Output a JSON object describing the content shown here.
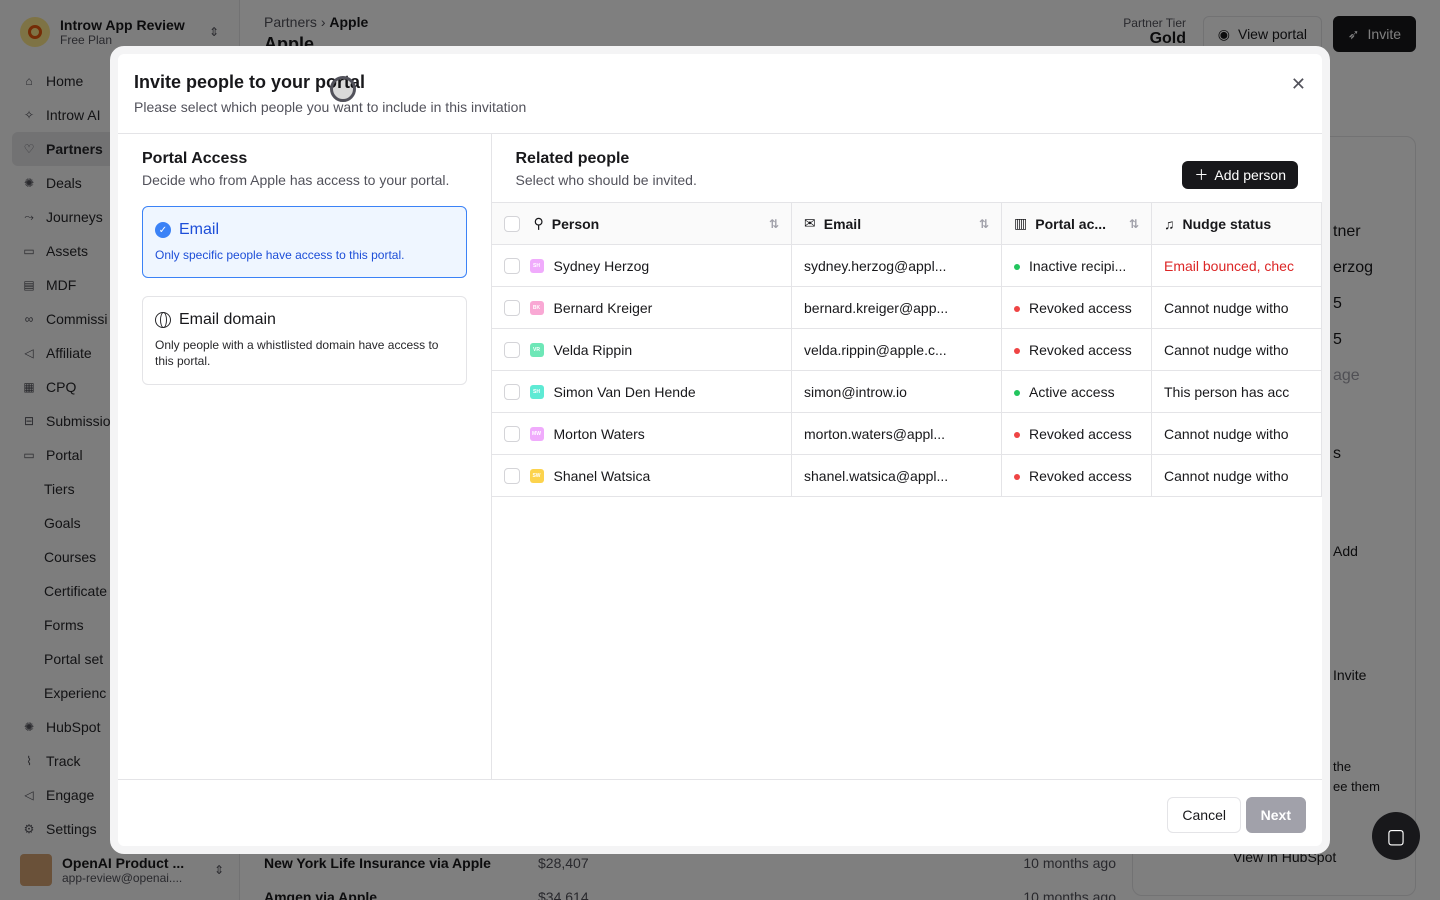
{
  "app": {
    "org_name": "Introw App Review",
    "org_plan": "Free Plan",
    "nav": [
      {
        "label": "Home",
        "icon": "home-icon",
        "glyph": "⌂"
      },
      {
        "label": "Introw AI",
        "icon": "sparkle-icon",
        "glyph": "✧"
      },
      {
        "label": "Partners",
        "icon": "handshake-icon",
        "glyph": "♡",
        "active": true
      },
      {
        "label": "Deals",
        "icon": "hubspot-icon",
        "glyph": "✺"
      },
      {
        "label": "Journeys",
        "icon": "route-icon",
        "glyph": "⤳"
      },
      {
        "label": "Assets",
        "icon": "folder-icon",
        "glyph": "▭"
      },
      {
        "label": "MDF",
        "icon": "document-icon",
        "glyph": "▤"
      },
      {
        "label": "Commissi",
        "icon": "link-icon",
        "glyph": "∞"
      },
      {
        "label": "Affiliate",
        "icon": "megaphone-icon",
        "glyph": "◁"
      },
      {
        "label": "CPQ",
        "icon": "calculator-icon",
        "glyph": "▦"
      },
      {
        "label": "Submissio",
        "icon": "inbox-icon",
        "glyph": "⊟"
      },
      {
        "label": "Portal",
        "icon": "monitor-icon",
        "glyph": "▭"
      },
      {
        "label": "Tiers",
        "sub": true
      },
      {
        "label": "Goals",
        "sub": true
      },
      {
        "label": "Courses",
        "sub": true
      },
      {
        "label": "Certificate",
        "sub": true
      },
      {
        "label": "Forms",
        "sub": true
      },
      {
        "label": "Portal set",
        "sub": true
      },
      {
        "label": "Experienc",
        "sub": true
      },
      {
        "label": "HubSpot",
        "icon": "hubspot-icon",
        "glyph": "✺"
      },
      {
        "label": "Track",
        "icon": "chart-icon",
        "glyph": "⌇"
      },
      {
        "label": "Engage",
        "icon": "megaphone-icon",
        "glyph": "◁"
      },
      {
        "label": "Settings",
        "icon": "gear-icon",
        "glyph": "⚙"
      }
    ],
    "user_name": "OpenAI Product ...",
    "user_email": "app-review@openai....",
    "breadcrumb_root": "Partners",
    "breadcrumb_current": "Apple",
    "page_title": "Apple",
    "tier_label": "Partner Tier",
    "tier_value": "Gold",
    "view_portal": "View portal",
    "invite": "Invite",
    "bg_rows": [
      {
        "name": "New York Life Insurance via Apple",
        "amount": "$28,407",
        "ago": "10 months ago"
      },
      {
        "name": "Amgen via Apple",
        "amount": "$34,614",
        "ago": "10 months ago"
      }
    ],
    "panel": {
      "partner": "tner",
      "herzog": "erzog",
      "s1": "5",
      "s2": "5",
      "age": "age",
      "s3": "s",
      "add": "Add",
      "invite": "Invite",
      "note1": "the",
      "note2": "ee them",
      "view_hubspot": "View in HubSpot"
    }
  },
  "modal": {
    "title": "Invite people to your portal",
    "subtitle": "Please select which people you want to include in this invitation",
    "access_title": "Portal Access",
    "access_sub": "Decide who from Apple has access to your portal.",
    "options": [
      {
        "label": "Email",
        "desc": "Only specific people have access to this portal.",
        "selected": true
      },
      {
        "label": "Email domain",
        "desc": "Only people with a whistlisted domain have access to this portal.",
        "selected": false
      }
    ],
    "related_title": "Related people",
    "related_sub": "Select who should be invited.",
    "add_person": "Add person",
    "columns": [
      "Person",
      "Email",
      "Portal ac...",
      "Nudge status"
    ],
    "rows": [
      {
        "initials": "SH",
        "avatar_color": "#f0abfc",
        "name": "Sydney Herzog",
        "email": "sydney.herzog@appl...",
        "status": "Inactive recipi...",
        "status_color": "#22c55e",
        "nudge": "Email bounced, chec",
        "nudge_red": true
      },
      {
        "initials": "BK",
        "avatar_color": "#f9a8d4",
        "name": "Bernard Kreiger",
        "email": "bernard.kreiger@app...",
        "status": "Revoked access",
        "status_color": "#ef4444",
        "nudge": "Cannot nudge witho",
        "nudge_red": false
      },
      {
        "initials": "VR",
        "avatar_color": "#6ee7b7",
        "name": "Velda Rippin",
        "email": "velda.rippin@apple.c...",
        "status": "Revoked access",
        "status_color": "#ef4444",
        "nudge": "Cannot nudge witho",
        "nudge_red": false
      },
      {
        "initials": "SH",
        "avatar_color": "#5eead4",
        "name": "Simon Van Den Hende",
        "email": "simon@introw.io",
        "status": "Active access",
        "status_color": "#22c55e",
        "nudge": "This person has acc",
        "nudge_red": false
      },
      {
        "initials": "MW",
        "avatar_color": "#f0abfc",
        "name": "Morton Waters",
        "email": "morton.waters@appl...",
        "status": "Revoked access",
        "status_color": "#ef4444",
        "nudge": "Cannot nudge witho",
        "nudge_red": false
      },
      {
        "initials": "SW",
        "avatar_color": "#fcd34d",
        "name": "Shanel Watsica",
        "email": "shanel.watsica@appl...",
        "status": "Revoked access",
        "status_color": "#ef4444",
        "nudge": "Cannot nudge witho",
        "nudge_red": false
      }
    ],
    "cancel": "Cancel",
    "next": "Next"
  }
}
